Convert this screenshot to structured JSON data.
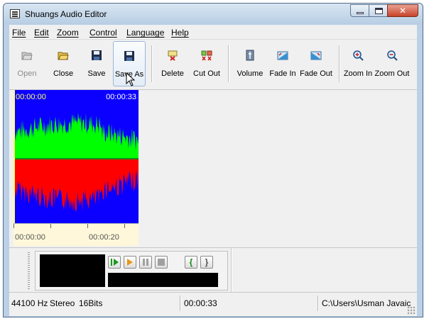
{
  "window": {
    "title": "Shuangs Audio Editor",
    "close_glyph": "✕"
  },
  "menu": [
    {
      "label": "File"
    },
    {
      "label": "Edit"
    },
    {
      "label": "Zoom"
    },
    {
      "label": "Control"
    },
    {
      "label": "Language"
    },
    {
      "label": "Help"
    }
  ],
  "toolbar": {
    "open": "Open",
    "close": "Close",
    "save": "Save",
    "save_as": "Save As",
    "delete": "Delete",
    "cut_out": "Cut Out",
    "volume": "Volume",
    "fade_in": "Fade In",
    "fade_out": "Fade Out",
    "zoom_in": "Zoom In",
    "zoom_out": "Zoom Out"
  },
  "waveform": {
    "start_time": "00:00:00",
    "end_time": "00:00:33",
    "ruler_start": "00:00:00",
    "ruler_mark": "00:00:20",
    "colors": {
      "background": "#0b00ff",
      "left_channel": "#00ff00",
      "right_channel": "#ff0000",
      "cursor": "#ffff66"
    }
  },
  "player": {
    "play_icon": "play-icon",
    "play_selection_icon": "play-selection-icon",
    "pause_icon": "pause-icon",
    "stop_icon": "stop-icon",
    "mark_start": "{",
    "mark_end": "}"
  },
  "status": {
    "sample_rate": "44100 Hz",
    "channels": "Stereo",
    "bits": "16Bits",
    "duration": "00:00:33",
    "path": "C:\\Users\\Usman Javaic"
  }
}
